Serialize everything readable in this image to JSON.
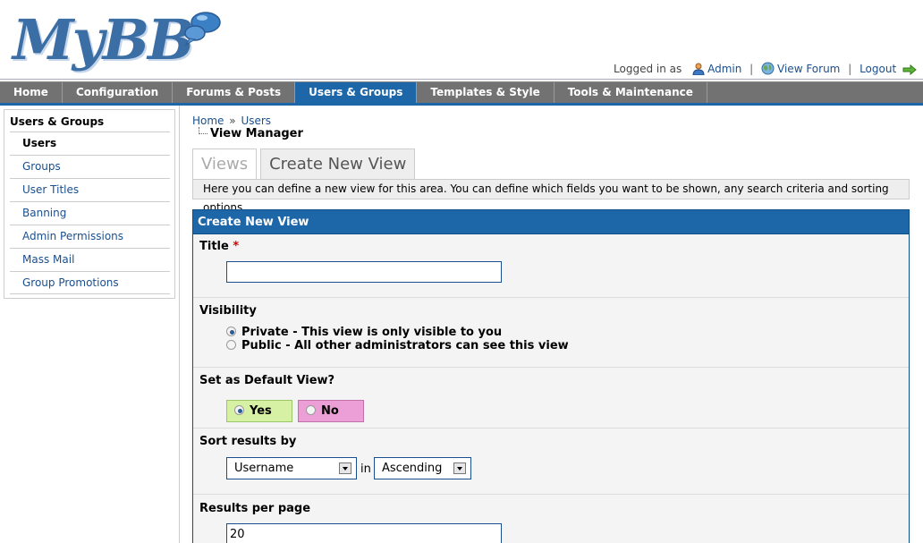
{
  "header": {
    "logo_text": "MyBB",
    "logged_in_as": "Logged in as",
    "user_link": "Admin",
    "view_forum": "View Forum",
    "logout": "Logout",
    "separator": "|"
  },
  "menu": {
    "items": [
      {
        "label": "Home"
      },
      {
        "label": "Configuration"
      },
      {
        "label": "Forums & Posts"
      },
      {
        "label": "Users & Groups"
      },
      {
        "label": "Templates & Style"
      },
      {
        "label": "Tools & Maintenance"
      }
    ],
    "active_index": 3
  },
  "sidebar": {
    "title": "Users & Groups",
    "items": [
      {
        "label": "Users"
      },
      {
        "label": "Groups"
      },
      {
        "label": "User Titles"
      },
      {
        "label": "Banning"
      },
      {
        "label": "Admin Permissions"
      },
      {
        "label": "Mass Mail"
      },
      {
        "label": "Group Promotions"
      }
    ]
  },
  "breadcrumb": {
    "home": "Home",
    "arrow": "»",
    "users": "Users"
  },
  "page_title": "View Manager",
  "tabs": [
    {
      "label": "Views"
    },
    {
      "label": "Create New View"
    }
  ],
  "tab_description": "Here you can define a new view for this area. You can define which fields you want to be shown, any search criteria and sorting options.",
  "form": {
    "heading": "Create New View",
    "title_label": "Title",
    "required_mark": "*",
    "title_value": "",
    "visibility_label": "Visibility",
    "visibility_private": "Private - This view is only visible to you",
    "visibility_public": "Public - All other administrators can see this view",
    "default_label": "Set as Default View?",
    "yes_label": "Yes",
    "no_label": "No",
    "sort_label": "Sort results by",
    "sort_field": "Username",
    "sort_in": "in",
    "sort_order": "Ascending",
    "per_page_label": "Results per page",
    "per_page_value": "20"
  },
  "colors": {
    "accent": "#1d66a8",
    "menu_bg": "#727272",
    "link": "#1a4f8e",
    "yes_bg": "#d6f0a4",
    "no_bg": "#ec9fd6"
  },
  "icons": {
    "user": "user-icon",
    "globe": "globe-icon",
    "logout": "logout-arrow-icon",
    "logo_bubble": "speech-bubble-icon"
  }
}
